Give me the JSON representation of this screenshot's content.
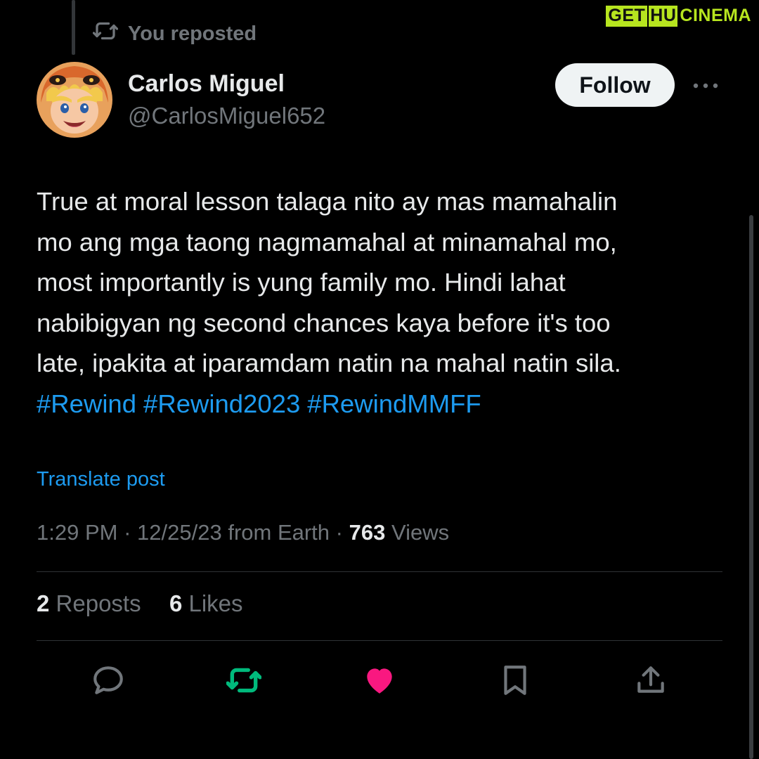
{
  "repost_banner": {
    "text": "You reposted",
    "icon": "repost-icon"
  },
  "watermark": {
    "part1": "GET",
    "part2": "HU",
    "part3": "CINEMA"
  },
  "author": {
    "name": "Carlos Miguel",
    "handle": "@CarlosMiguel652",
    "avatar": "avatar-image"
  },
  "header_actions": {
    "follow_label": "Follow",
    "more_icon": "more-horizontal-icon"
  },
  "tweet": {
    "lines": [
      "True at moral lesson talaga nito ay mas mamahalin",
      "mo ang mga taong nagmamahal at minamahal mo,",
      "most importantly is yung family mo. Hindi lahat",
      "nabibigyan ng second chances kaya before it's too",
      "late, ipakita at iparamdam natin na mahal natin sila."
    ],
    "hashtags": [
      "#Rewind",
      "#Rewind2023",
      "#RewindMMFF"
    ],
    "translate_label": "Translate post"
  },
  "meta": {
    "time": "1:29 PM",
    "date": "12/25/23",
    "source": "from Earth",
    "separator": "·",
    "views_count": "763",
    "views_label": "Views"
  },
  "stats": {
    "reposts_count": "2",
    "reposts_label": "Reposts",
    "likes_count": "6",
    "likes_label": "Likes"
  },
  "actions": [
    {
      "icon": "reply-icon",
      "active": false
    },
    {
      "icon": "repost-icon",
      "active": true
    },
    {
      "icon": "heart-icon",
      "active": true
    },
    {
      "icon": "bookmark-icon",
      "active": false
    },
    {
      "icon": "share-icon",
      "active": false
    }
  ],
  "colors": {
    "background": "#000000",
    "text": "#e7e9ea",
    "secondary": "#71767b",
    "link": "#1d9bf0",
    "repost_active": "#00ba7c",
    "like_active": "#f91880",
    "watermark": "#b7e51f"
  }
}
